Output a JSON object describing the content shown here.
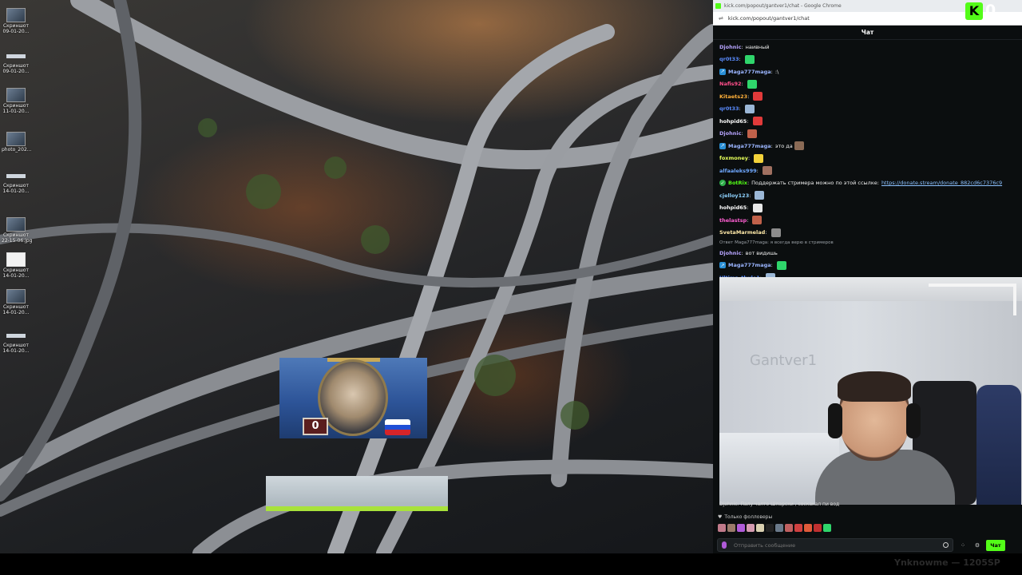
{
  "desktop": {
    "icons": [
      {
        "label": "Скриншот\n09-01-20...",
        "kind": "photo"
      },
      {
        "label": "Скриншот\n09-01-20...",
        "kind": "bar"
      },
      {
        "label": "Скриншот\n11-01-20...",
        "kind": "photo"
      },
      {
        "label": "photo_202...",
        "kind": "photo"
      },
      {
        "label": "Скриншот\n14-01-20...",
        "kind": "bar"
      },
      {
        "label": "Скриншот\n22-15-06.jpg",
        "kind": "photo"
      },
      {
        "label": "Скриншот\n14-01-20...",
        "kind": "white"
      },
      {
        "label": "Скриншот\n14-01-20...",
        "kind": "photo"
      },
      {
        "label": "Скриншот\n14-01-20...",
        "kind": "bar"
      }
    ],
    "overlay_score": "0"
  },
  "browser": {
    "title": "kick.com/popout/gantver1/chat - Google Chrome",
    "url": "kick.com/popout/gantver1/chat"
  },
  "kick": {
    "count": "0",
    "logo_letter": "K"
  },
  "chat": {
    "header": "Чат",
    "messages": [
      {
        "user": "Djohnic",
        "color": "#b7a4ff",
        "text": "наивный",
        "badge": "",
        "emote": ""
      },
      {
        "user": "qr0t33",
        "color": "#5a8cff",
        "text": "",
        "badge": "",
        "emote": "#2fd56b"
      },
      {
        "user": "Maga777maga",
        "color": "#9bb5ff",
        "text": ":\\",
        "badge": "blue",
        "emote": ""
      },
      {
        "user": "Nafis92",
        "color": "#ff4f8b",
        "text": "",
        "badge": "",
        "emote": "#2fd56b"
      },
      {
        "user": "Kitaets23",
        "color": "#ffb03a",
        "text": "",
        "badge": "",
        "emote": "#e13a3a"
      },
      {
        "user": "qr0t33",
        "color": "#5a8cff",
        "text": "",
        "badge": "",
        "emote": "#9bb7d6"
      },
      {
        "user": "hohpid65",
        "color": "#ffffff",
        "text": "",
        "badge": "",
        "emote": "#e13a3a"
      },
      {
        "user": "Djohnic",
        "color": "#b7a4ff",
        "text": "",
        "badge": "",
        "emote": "#c0614a"
      },
      {
        "user": "Maga777maga",
        "color": "#9bb5ff",
        "text": "это да",
        "badge": "blue",
        "emote": "#8a6a55"
      },
      {
        "user": "foxmoney",
        "color": "#e6ff5a",
        "text": "",
        "badge": "",
        "emote": "#f3d23a"
      },
      {
        "user": "alfaaleks999",
        "color": "#6fa8ff",
        "text": "",
        "badge": "",
        "emote": "#a07060"
      },
      {
        "user": "BotRix",
        "color": "#53fc18",
        "text": "Поддержать стримера можно по этой ссылке:",
        "link": "https://donate.stream/donate_882cd6c7376c9",
        "badge": "bot",
        "emote": ""
      },
      {
        "user": "cjelloy123",
        "color": "#8fd3ff",
        "text": "",
        "badge": "",
        "emote": "#9bb7d6"
      },
      {
        "user": "hohpid65",
        "color": "#ffffff",
        "text": "",
        "badge": "",
        "emote": "#e8e8e8"
      },
      {
        "user": "thelastsp",
        "color": "#ff5fd2",
        "text": "",
        "badge": "",
        "emote": "#c0614a"
      },
      {
        "user": "SvetaMarmelad",
        "color": "#ffe9a8",
        "text": "",
        "badge": "",
        "emote": "#8c8c8c"
      },
      {
        "reply": "Ответ Maga777maga: я всегда верю в стримеров"
      },
      {
        "user": "Djohnic",
        "color": "#b7a4ff",
        "text": "вот видишь",
        "badge": "",
        "emote": ""
      },
      {
        "user": "Maga777maga",
        "color": "#9bb5ff",
        "text": "",
        "badge": "blue",
        "emote": "#2fd56b"
      },
      {
        "user": "Ultima_thule1",
        "color": "#5a8cff",
        "text": "",
        "badge": "",
        "emote": "#9bb7d6"
      }
    ],
    "webcam_wall_text": "Gantver1",
    "partial_message": "Djohnic: Палу чалто Шпарски , соскакал пи вод",
    "followers_only": "Только фолловеры",
    "emote_colors": [
      "#c07a8a",
      "#9a7a6a",
      "#b05bd9",
      "#d49bb0",
      "#d9d0b0",
      "#222",
      "#6a7a8a",
      "#c06060",
      "#d04040",
      "#e05a3a",
      "#c03030",
      "#2fd56b"
    ],
    "input_placeholder": "Отправить сообщение",
    "send_label": "Чат"
  },
  "watermark": "Ynknowme — 1205SP"
}
